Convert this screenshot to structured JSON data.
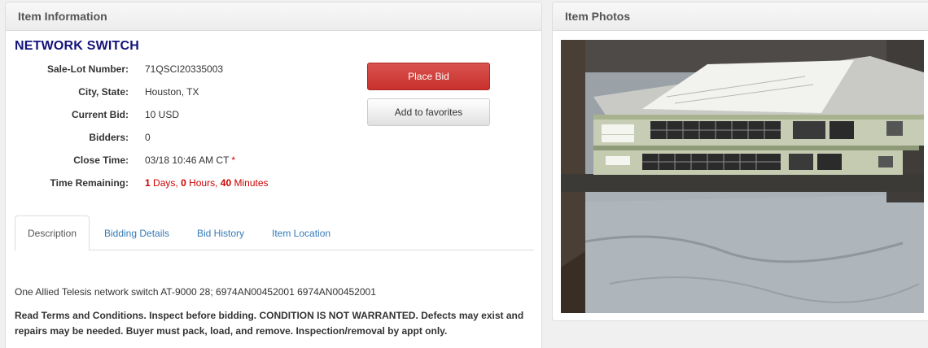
{
  "info_panel": {
    "header": "Item Information"
  },
  "item": {
    "title": "NETWORK SWITCH",
    "fields": [
      {
        "label": "Sale-Lot Number:",
        "value": "71QSCI20335003"
      },
      {
        "label": "City, State:",
        "value": "Houston, TX"
      },
      {
        "label": "Current Bid:",
        "value": "10 USD"
      },
      {
        "label": "Bidders:",
        "value": "0"
      },
      {
        "label": "Close Time:",
        "value": "03/18 10:46 AM CT",
        "marker": "*"
      }
    ],
    "time_remaining": {
      "label": "Time Remaining:",
      "days": "1",
      "days_unit": "Days,",
      "hours": "0",
      "hours_unit": "Hours,",
      "minutes": "40",
      "minutes_unit": "Minutes"
    }
  },
  "actions": {
    "place_bid": "Place Bid",
    "add_favorites": "Add to favorites"
  },
  "tabs": [
    {
      "label": "Description",
      "active": true
    },
    {
      "label": "Bidding Details"
    },
    {
      "label": "Bid History"
    },
    {
      "label": "Item Location"
    }
  ],
  "description": {
    "line1": "One Allied Telesis network switch AT-9000 28; 6974AN00452001 6974AN00452001",
    "terms": "Read Terms and Conditions. Inspect before bidding. CONDITION IS NOT WARRANTED. Defects may exist and repairs may be needed. Buyer must pack, load, and remove. Inspection/removal by appt only."
  },
  "photo_panel": {
    "header": "Item Photos"
  },
  "colors": {
    "title": "#14137a",
    "accent_red": "#cc0000",
    "link": "#337ab7",
    "bid_button": "#d9534f"
  }
}
